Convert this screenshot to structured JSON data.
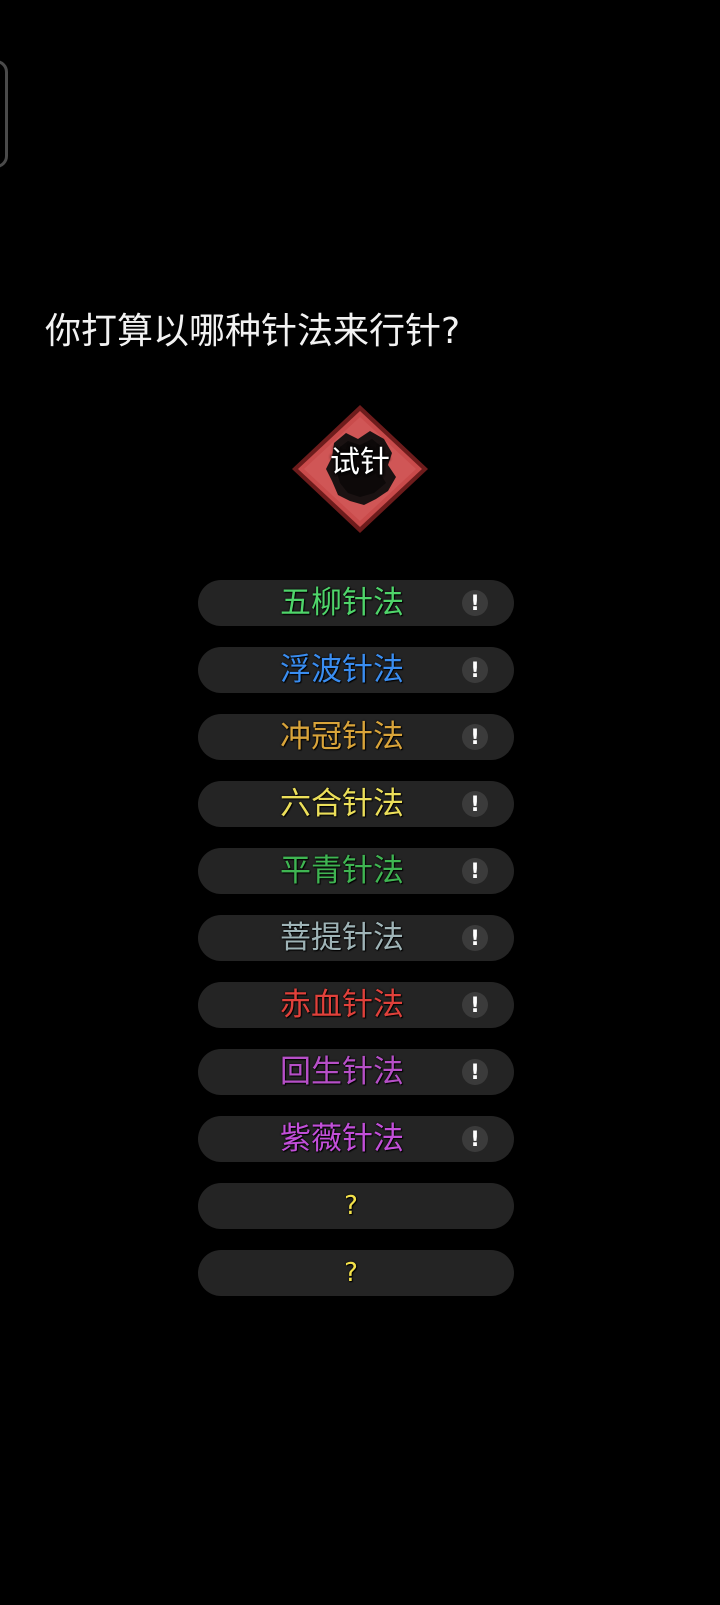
{
  "prompt": {
    "question": "你打算以哪种针法来行针?"
  },
  "badge": {
    "label": "试针"
  },
  "options": [
    {
      "label": "五柳针法",
      "color": "#4fd46a",
      "info_icon": "!"
    },
    {
      "label": "浮波针法",
      "color": "#3a8df0",
      "info_icon": "!"
    },
    {
      "label": "冲冠针法",
      "color": "#d9a43a",
      "info_icon": "!"
    },
    {
      "label": "六合针法",
      "color": "#ecdf5a",
      "info_icon": "!"
    },
    {
      "label": "平青针法",
      "color": "#3fb552",
      "info_icon": "!"
    },
    {
      "label": "菩提针法",
      "color": "#9fb4b7",
      "info_icon": "!"
    },
    {
      "label": "赤血针法",
      "color": "#e0413b",
      "info_icon": "!"
    },
    {
      "label": "回生针法",
      "color": "#b64fc7",
      "info_icon": "!"
    },
    {
      "label": "紫薇针法",
      "color": "#c24fd9",
      "info_icon": "!"
    },
    {
      "label": "?",
      "color": "#f3e14a"
    },
    {
      "label": "?",
      "color": "#f3e14a"
    }
  ],
  "colors": {
    "background": "#000000",
    "button_bg": "#242424",
    "badge_red": "#c94b4b"
  }
}
